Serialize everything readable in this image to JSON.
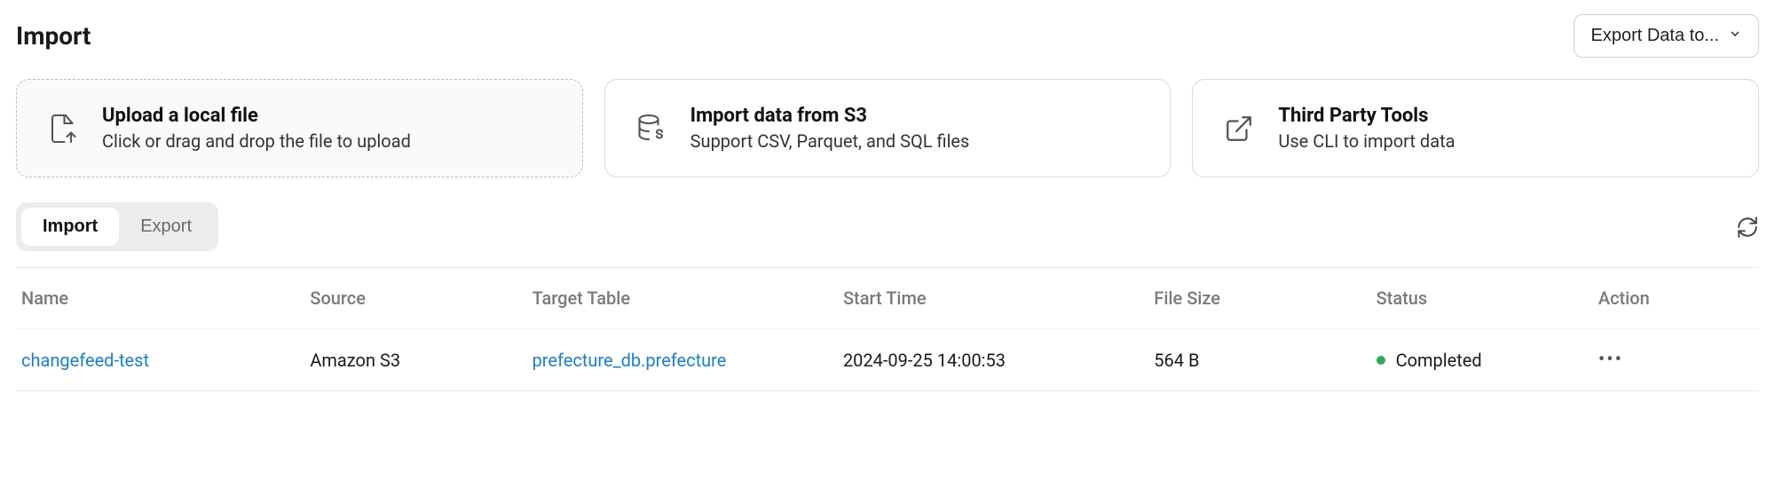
{
  "header": {
    "title": "Import",
    "export_button_label": "Export Data to..."
  },
  "cards": {
    "upload": {
      "title": "Upload a local file",
      "subtitle": "Click or drag and drop the file to upload",
      "icon_name": "file-upload-icon"
    },
    "s3": {
      "title": "Import data from S3",
      "subtitle": "Support CSV, Parquet, and SQL files",
      "icon_name": "database-s-icon"
    },
    "tools": {
      "title": "Third Party Tools",
      "subtitle": "Use CLI to import data",
      "icon_name": "external-link-icon"
    }
  },
  "tabs": {
    "items": [
      {
        "label": "Import",
        "active": true
      },
      {
        "label": "Export",
        "active": false
      }
    ]
  },
  "table": {
    "columns": {
      "name": "Name",
      "source": "Source",
      "target": "Target Table",
      "start": "Start Time",
      "size": "File Size",
      "status": "Status",
      "action": "Action"
    },
    "rows": [
      {
        "name": "changefeed-test",
        "source": "Amazon S3",
        "target": "prefecture_db.prefecture",
        "start": "2024-09-25 14:00:53",
        "size": "564 B",
        "status": "Completed",
        "status_color": "#2fa85b"
      }
    ]
  }
}
